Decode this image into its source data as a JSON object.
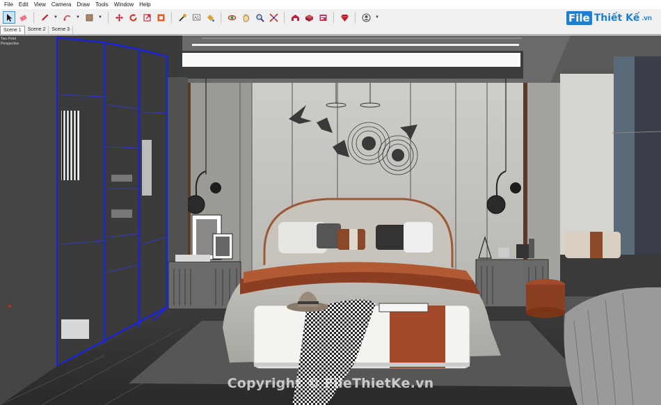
{
  "menu": [
    "File",
    "Edit",
    "View",
    "Camera",
    "Draw",
    "Tools",
    "Window",
    "Help"
  ],
  "scenes": [
    "Scene 1",
    "Scene 2",
    "Scene 3"
  ],
  "active_scene": "Scene 1",
  "view_labels": [
    "Two Point",
    "Perspective"
  ],
  "watermark": "Copyright © FileThietKe.vn",
  "logo": {
    "file": "File",
    "rest": "Thiết Kế",
    "domain": ".vn"
  },
  "tools": [
    {
      "name": "select-tool-icon",
      "color": "#3b7ac7"
    },
    {
      "name": "eraser-tool-icon",
      "color": "#e05870"
    },
    {
      "name": "pencil-tool-icon",
      "color": "#c02030"
    },
    {
      "name": "shape-tool-icon",
      "color": "#d04050"
    },
    {
      "name": "push-pull-tool-icon",
      "color": "#9a7a5a"
    },
    {
      "name": "move-tool-icon",
      "color": "#c02030"
    },
    {
      "name": "rotate-tool-icon",
      "color": "#d03030"
    },
    {
      "name": "scale-tool-icon",
      "color": "#c03040"
    },
    {
      "name": "offset-tool-icon",
      "color": "#e06020"
    },
    {
      "name": "tape-measure-icon",
      "color": "#8a6a20"
    },
    {
      "name": "text-tool-icon",
      "color": "#555555"
    },
    {
      "name": "paint-bucket-icon",
      "color": "#d8a030"
    },
    {
      "name": "orbit-tool-icon",
      "color": "#cc2020"
    },
    {
      "name": "pan-tool-icon",
      "color": "#e0c070"
    },
    {
      "name": "zoom-tool-icon",
      "color": "#404080"
    },
    {
      "name": "zoom-extents-icon",
      "color": "#c03030"
    },
    {
      "name": "warehouse-icon",
      "color": "#c02040"
    },
    {
      "name": "components-icon",
      "color": "#b03040"
    },
    {
      "name": "extension-icon",
      "color": "#c83050"
    },
    {
      "name": "ruby-icon",
      "color": "#c01828"
    },
    {
      "name": "account-icon",
      "color": "#555555"
    }
  ],
  "colors": {
    "selection_blue": "#1a22e6",
    "accent_orange": "#a44a2a"
  }
}
